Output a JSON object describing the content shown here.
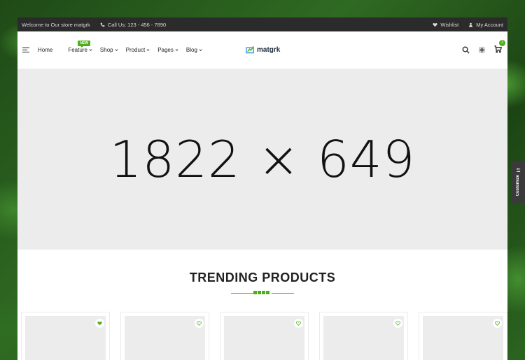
{
  "topbar": {
    "welcome": "Welcome to Our store matgrk",
    "phone": "Call Us: 123 - 456 - 7890",
    "wishlist": "Wishlist",
    "account": "My Account"
  },
  "nav": {
    "items": [
      {
        "label": "Home"
      },
      {
        "label": "Feature",
        "badge": "NEW"
      },
      {
        "label": "Shop"
      },
      {
        "label": "Product"
      },
      {
        "label": "Pages"
      },
      {
        "label": "Blog"
      }
    ]
  },
  "logo": {
    "text": "matgrk"
  },
  "cart": {
    "count": "2"
  },
  "hero": {
    "placeholder": "1822 × 649"
  },
  "trending": {
    "title": "TRENDING PRODUCTS"
  },
  "customize": {
    "label": "Customize"
  },
  "colors": {
    "accent": "#4caf1a",
    "topbar": "#2b2b2b"
  },
  "products": [
    {
      "wishlist_active": true
    },
    {
      "wishlist_active": false
    },
    {
      "wishlist_active": false
    },
    {
      "wishlist_active": false
    },
    {
      "wishlist_active": false
    }
  ]
}
